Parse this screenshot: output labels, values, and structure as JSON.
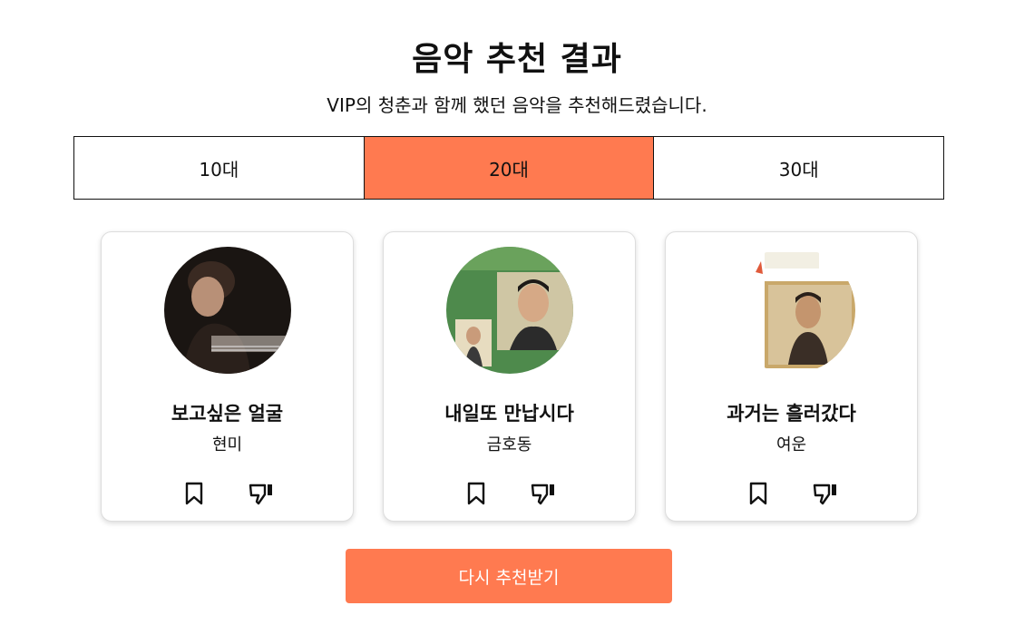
{
  "header": {
    "title": "음악 추천 결과",
    "subtitle": "VIP의 청춘과 함께 했던 음악을 추천해드렸습니다."
  },
  "tabs": [
    {
      "label": "10대",
      "active": false
    },
    {
      "label": "20대",
      "active": true
    },
    {
      "label": "30대",
      "active": false
    }
  ],
  "songs": [
    {
      "title": "보고싶은 얼굴",
      "artist": "현미",
      "cover_icon": "album-cover-icon"
    },
    {
      "title": "내일또 만납시다",
      "artist": "금호동",
      "cover_icon": "album-cover-icon"
    },
    {
      "title": "과거는 흘러갔다",
      "artist": "여운",
      "cover_icon": "album-cover-icon"
    }
  ],
  "actions": {
    "bookmark_icon": "bookmark-icon",
    "dislike_icon": "thumbs-down-icon"
  },
  "retry_button": {
    "label": "다시 추천받기"
  },
  "colors": {
    "accent": "#ff7a50",
    "border": "#111111"
  }
}
